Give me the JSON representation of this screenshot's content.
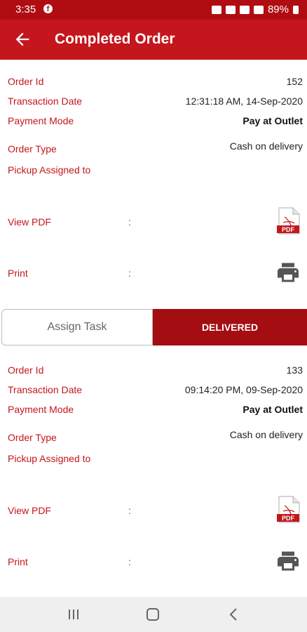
{
  "status_bar": {
    "time": "3:35",
    "battery": "89%"
  },
  "app_bar": {
    "title": "Completed Order"
  },
  "labels": {
    "order_id": "Order Id",
    "transaction_date": "Transaction Date",
    "payment_mode": "Payment Mode",
    "order_type": "Order Type",
    "pickup_assigned": "Pickup Assigned to",
    "view_pdf": "View PDF",
    "print": "Print",
    "colon": ":"
  },
  "orders": [
    {
      "order_id": "152",
      "transaction_date": "12:31:18 AM, 14-Sep-2020",
      "payment_mode": "Pay at Outlet",
      "order_type": "Cash on delivery",
      "pickup_assigned": ""
    },
    {
      "order_id": "133",
      "transaction_date": "09:14:20 PM, 09-Sep-2020",
      "payment_mode": "Pay at Outlet",
      "order_type": "Cash on delivery",
      "pickup_assigned": ""
    }
  ],
  "tabs": {
    "assign_task": "Assign Task",
    "delivered": "DELIVERED"
  },
  "icons": {
    "back": "arrow-left-icon",
    "pdf": "pdf-file-icon",
    "print": "printer-icon"
  },
  "colors": {
    "primary": "#c4161c",
    "dark_primary": "#a40d12"
  }
}
